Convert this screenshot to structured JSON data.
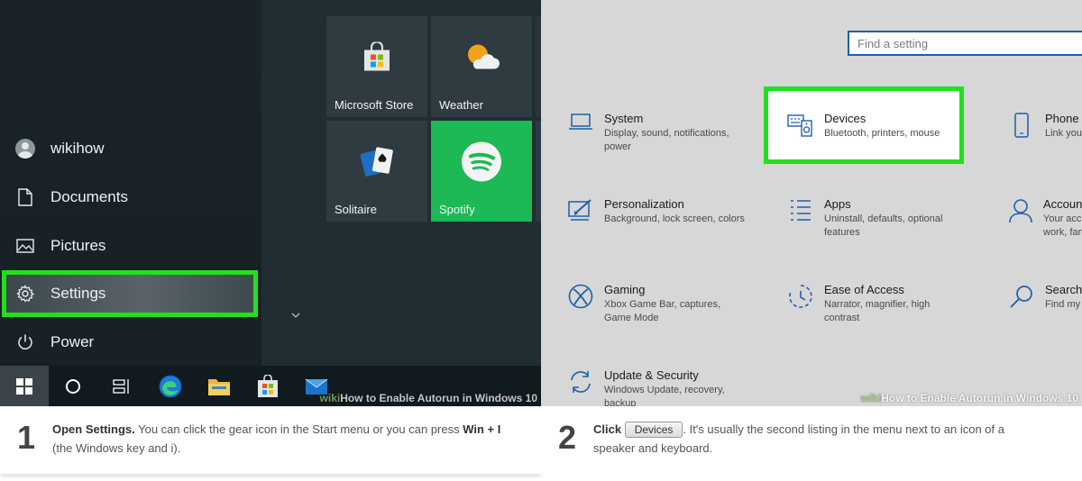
{
  "left_panel": {
    "start_menu": {
      "user": "wikihow",
      "documents": "Documents",
      "pictures": "Pictures",
      "settings": "Settings",
      "power": "Power"
    },
    "tiles": {
      "store": "Microsoft Store",
      "weather": "Weather",
      "solitaire": "Solitaire",
      "spotify": "Spotify"
    },
    "watermark": {
      "brand": "wiki",
      "text": "How to Enable Autorun in Windows 10"
    }
  },
  "right_panel": {
    "search_placeholder": "Find a setting",
    "categories": {
      "system": {
        "title": "System",
        "desc": "Display, sound, notifications, power"
      },
      "devices": {
        "title": "Devices",
        "desc": "Bluetooth, printers, mouse"
      },
      "phone": {
        "title": "Phone",
        "desc": "Link you"
      },
      "personalization": {
        "title": "Personalization",
        "desc": "Background, lock screen, colors"
      },
      "apps": {
        "title": "Apps",
        "desc": "Uninstall, defaults, optional features"
      },
      "accounts": {
        "title": "Accoun",
        "desc": "Your acc work, fan"
      },
      "gaming": {
        "title": "Gaming",
        "desc": "Xbox Game Bar, captures, Game Mode"
      },
      "ease": {
        "title": "Ease of Access",
        "desc": "Narrator, magnifier, high contrast"
      },
      "search": {
        "title": "Search",
        "desc": "Find my"
      },
      "update": {
        "title": "Update & Security",
        "desc": "Windows Update, recovery, backup"
      }
    },
    "watermark": {
      "brand": "wiki",
      "text": "How to Enable Autorun in Windows 10"
    }
  },
  "captions": {
    "step1": {
      "number": "1",
      "bold": "Open Settings.",
      "text_a": " You can click the gear icon in the Start menu or you can press ",
      "bold_b": "Win + I",
      "text_b": " (the Windows key and i)."
    },
    "step2": {
      "number": "2",
      "bold": "Click",
      "button": "Devices",
      "text": ". It's usually the second listing in the menu next to an icon of a speaker and keyboard."
    }
  },
  "colors": {
    "highlight": "#22e01e",
    "windows_blue": "#1f5fa8",
    "spotify_green": "#1db954"
  }
}
